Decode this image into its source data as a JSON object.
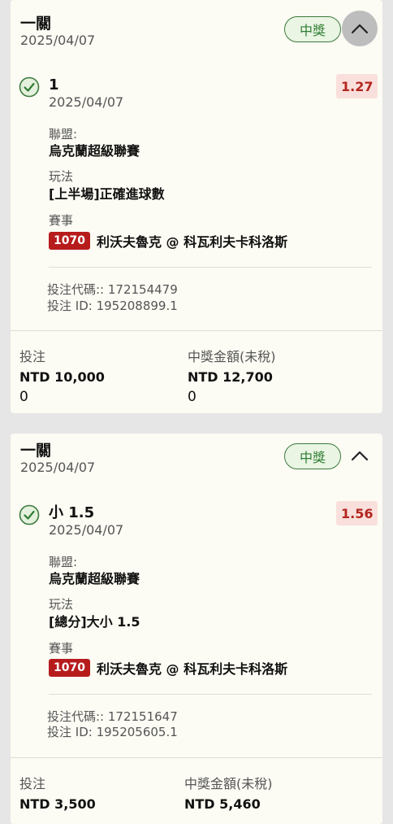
{
  "bets": [
    {
      "bet_type": "一關",
      "date": "2025/04/07",
      "status": "中獎",
      "selection": {
        "name": "1",
        "date": "2025/04/07",
        "odds": "1.27",
        "league_label": "聯盟:",
        "league": "烏克蘭超級聯賽",
        "market_label": "玩法",
        "market": "[上半場]正確進球數",
        "event_label": "賽事",
        "event_code": "1070",
        "event_name": "利沃夫魯克 @ 科瓦利夫卡科洛斯"
      },
      "bet_code": "投注代碼:: 172154479",
      "bet_id": "投注 ID: 195208899.1",
      "stake_label": "投注",
      "stake": "NTD 10,000",
      "stake_extra": "0",
      "payout_label": "中獎金額(未稅)",
      "payout": "NTD 12,700",
      "payout_extra": "0"
    },
    {
      "bet_type": "一關",
      "date": "2025/04/07",
      "status": "中獎",
      "selection": {
        "name": "小 1.5",
        "date": "2025/04/07",
        "odds": "1.56",
        "league_label": "聯盟:",
        "league": "烏克蘭超級聯賽",
        "market_label": "玩法",
        "market": "[總分]大小 1.5",
        "event_label": "賽事",
        "event_code": "1070",
        "event_name": "利沃夫魯克 @ 科瓦利夫卡科洛斯"
      },
      "bet_code": "投注代碼:: 172151647",
      "bet_id": "投注 ID: 195205605.1",
      "stake_label": "投注",
      "stake": "NTD 3,500",
      "payout_label": "中獎金額(未稅)",
      "payout": "NTD 5,460"
    }
  ],
  "icons": {
    "check": "check-circle-icon",
    "collapse": "chevron-up-icon"
  },
  "colors": {
    "won": "#2e7d32",
    "odds": "#b3261e",
    "event_badge": "#b71c1c"
  }
}
